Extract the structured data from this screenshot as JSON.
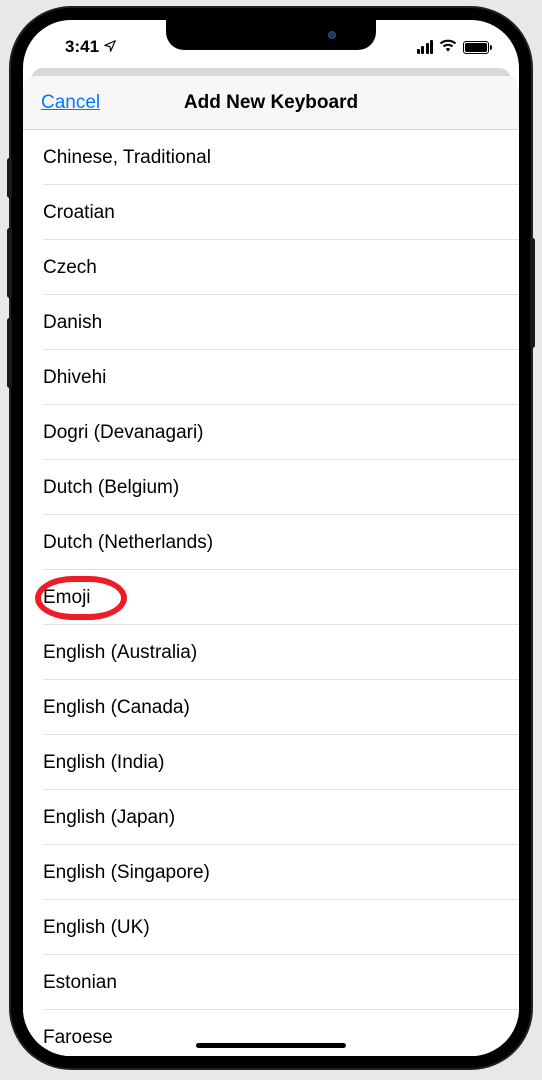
{
  "status_bar": {
    "time": "3:41"
  },
  "nav": {
    "cancel": "Cancel",
    "title": "Add New Keyboard"
  },
  "keyboards": [
    {
      "label": "Chinese, Traditional",
      "highlighted": false
    },
    {
      "label": "Croatian",
      "highlighted": false
    },
    {
      "label": "Czech",
      "highlighted": false
    },
    {
      "label": "Danish",
      "highlighted": false
    },
    {
      "label": "Dhivehi",
      "highlighted": false
    },
    {
      "label": "Dogri (Devanagari)",
      "highlighted": false
    },
    {
      "label": "Dutch (Belgium)",
      "highlighted": false
    },
    {
      "label": "Dutch (Netherlands)",
      "highlighted": false
    },
    {
      "label": "Emoji",
      "highlighted": true
    },
    {
      "label": "English (Australia)",
      "highlighted": false
    },
    {
      "label": "English (Canada)",
      "highlighted": false
    },
    {
      "label": "English (India)",
      "highlighted": false
    },
    {
      "label": "English (Japan)",
      "highlighted": false
    },
    {
      "label": "English (Singapore)",
      "highlighted": false
    },
    {
      "label": "English (UK)",
      "highlighted": false
    },
    {
      "label": "Estonian",
      "highlighted": false
    },
    {
      "label": "Faroese",
      "highlighted": false
    }
  ]
}
